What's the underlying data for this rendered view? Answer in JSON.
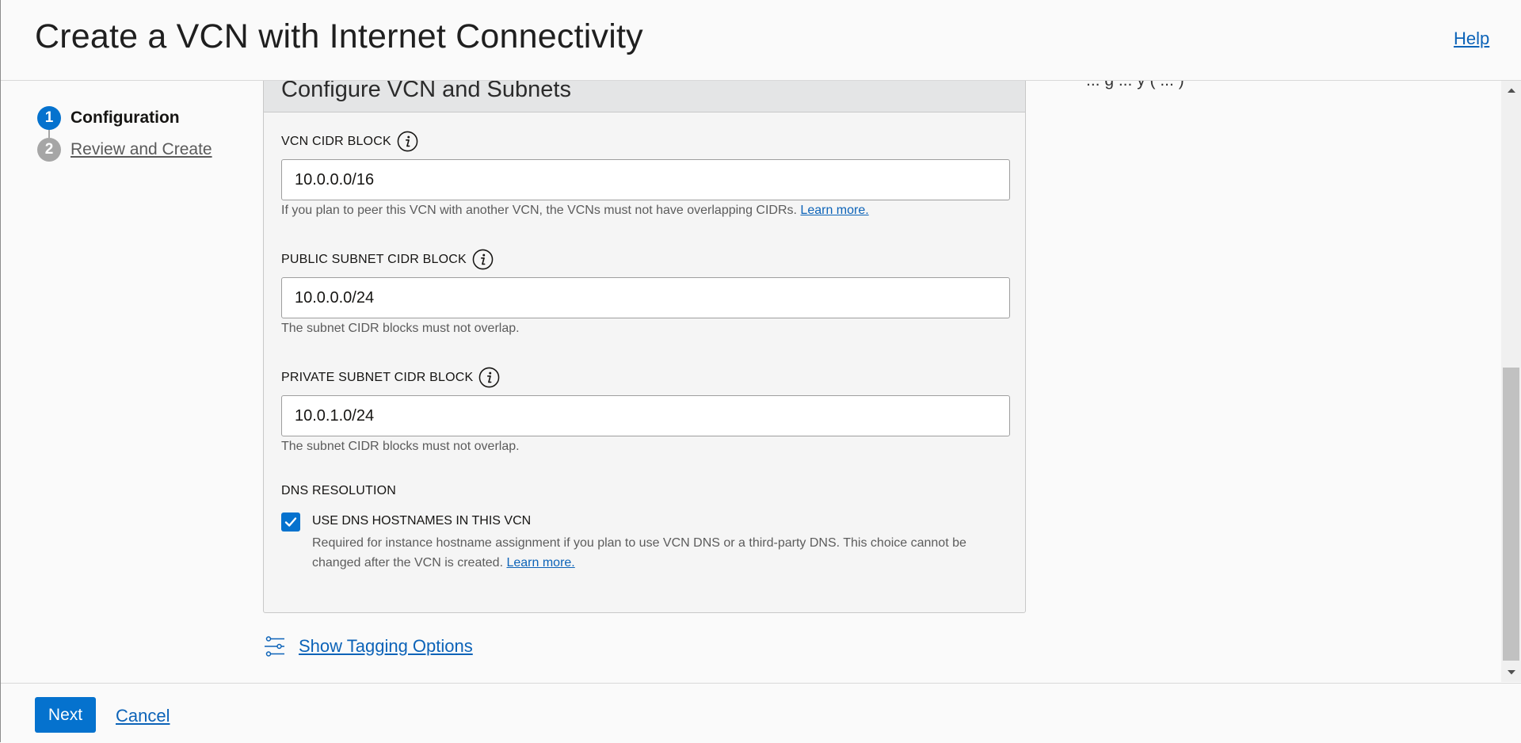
{
  "header": {
    "title": "Create a VCN with Internet Connectivity",
    "help_label": "Help"
  },
  "steps": [
    {
      "number": "1",
      "label": "Configuration",
      "state": "current"
    },
    {
      "number": "2",
      "label": "Review and Create",
      "state": "pending"
    }
  ],
  "partial_text": "... g ... y ( ... )",
  "panel": {
    "title": "Configure VCN and Subnets",
    "vcn_cidr": {
      "label": "VCN CIDR BLOCK",
      "value": "10.0.0.0/16",
      "help": "If you plan to peer this VCN with another VCN, the VCNs must not have overlapping CIDRs.",
      "help_link": "Learn more."
    },
    "public_subnet": {
      "label": "PUBLIC SUBNET CIDR BLOCK",
      "value": "10.0.0.0/24",
      "help": "The subnet CIDR blocks must not overlap."
    },
    "private_subnet": {
      "label": "PRIVATE SUBNET CIDR BLOCK",
      "value": "10.0.1.0/24",
      "help": "The subnet CIDR blocks must not overlap."
    },
    "dns": {
      "section_label": "DNS RESOLUTION",
      "checkbox_label": "USE DNS HOSTNAMES IN THIS VCN",
      "checked": true,
      "description": "Required for instance hostname assignment if you plan to use VCN DNS or a third-party DNS. This choice cannot be changed after the VCN is created.",
      "learn_more": "Learn more."
    }
  },
  "tagging": {
    "label": "Show Tagging Options",
    "icon": "sliders-icon"
  },
  "footer": {
    "next_label": "Next",
    "cancel_label": "Cancel"
  },
  "colors": {
    "accent": "#0572ce",
    "link": "#0c63b8",
    "panel_bg": "#f5f5f5",
    "panel_header_bg": "#e4e5e6"
  }
}
